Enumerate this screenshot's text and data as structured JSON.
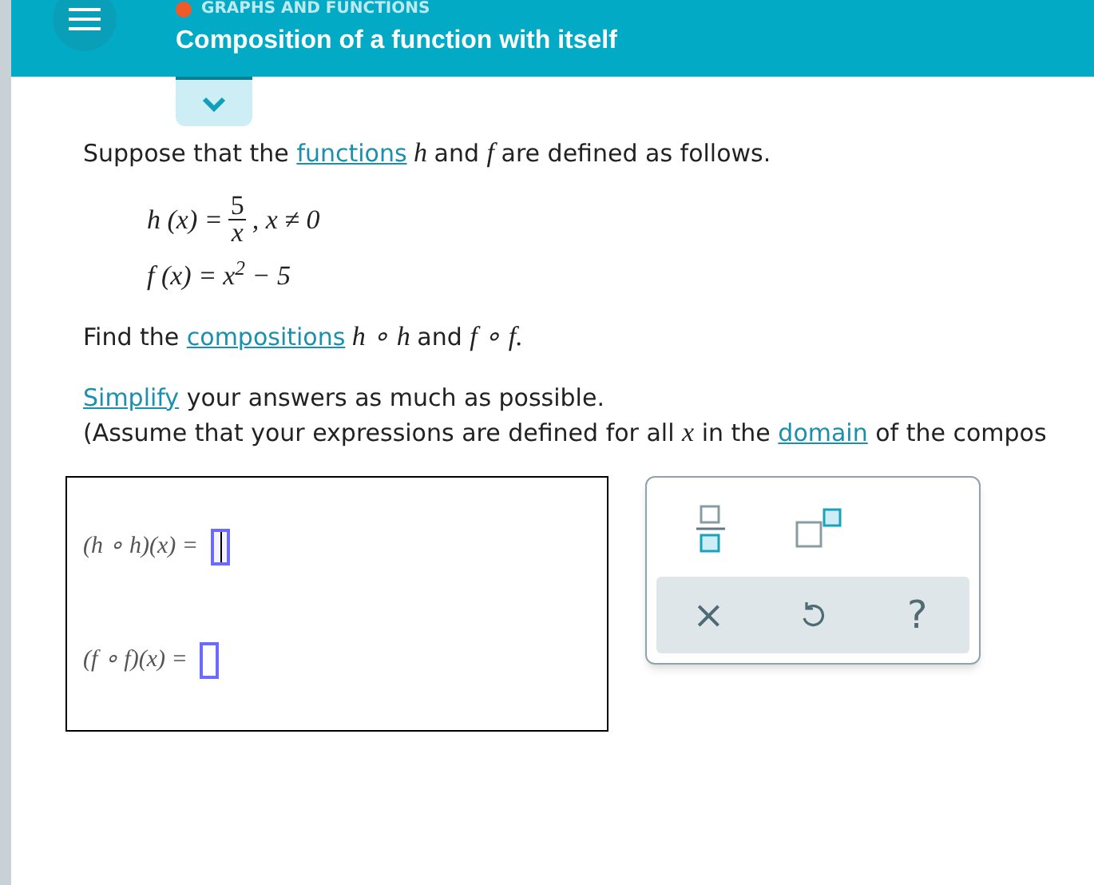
{
  "header": {
    "category": "GRAPHS AND FUNCTIONS",
    "title": "Composition of a function with itself"
  },
  "intro": [
    {
      "kind": "text",
      "text": "Suppose that the "
    },
    {
      "kind": "link",
      "text": "functions"
    },
    {
      "kind": "math",
      "text": " h "
    },
    {
      "kind": "text",
      "text": "and "
    },
    {
      "kind": "math",
      "text": "f "
    },
    {
      "kind": "text",
      "text": "are defined as follows."
    }
  ],
  "definitions": [
    {
      "kind": "fraction",
      "lhs": "h (x) =",
      "numerator": "5",
      "denominator": "x",
      "rest": ", x ≠ 0"
    },
    {
      "kind": "plain",
      "lhs": "f (x) =",
      "rest": "x$^{2}$ − 5"
    }
  ],
  "task": [
    {
      "kind": "text",
      "text": "Find the "
    },
    {
      "kind": "link",
      "text": "compositions"
    },
    {
      "kind": "math",
      "text": " h ∘ h "
    },
    {
      "kind": "text",
      "text": "and "
    },
    {
      "kind": "math",
      "text": "f ∘ f."
    }
  ],
  "instructions": [
    [
      {
        "kind": "link",
        "text": "Simplify"
      },
      {
        "kind": "text",
        "text": " your answers as much as possible."
      }
    ],
    [
      {
        "kind": "text",
        "text": "(Assume that your expressions are defined for all "
      },
      {
        "kind": "math",
        "text": "x"
      },
      {
        "kind": "text",
        "text": " in the "
      },
      {
        "kind": "link",
        "text": "domain"
      },
      {
        "kind": "text",
        "text": " of the compos"
      }
    ]
  ],
  "answers": [
    {
      "label": "(h ∘ h)(x) =",
      "selected": true
    },
    {
      "label": "(f ∘ f)(x) =",
      "selected": false
    }
  ],
  "palette": {
    "tools": [
      {
        "kind": "fraction"
      },
      {
        "kind": "exponent"
      }
    ],
    "actions": [
      {
        "kind": "clear",
        "text": "×"
      },
      {
        "kind": "undo"
      },
      {
        "kind": "help",
        "text": "?"
      }
    ]
  }
}
